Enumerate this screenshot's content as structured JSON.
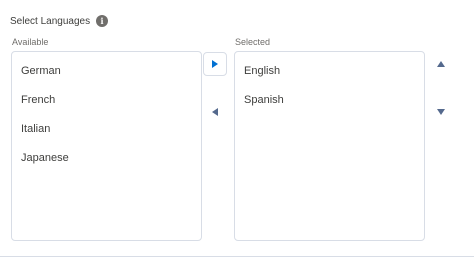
{
  "header": {
    "title": "Select Languages",
    "info_icon": "i"
  },
  "available": {
    "label": "Available",
    "items": [
      "German",
      "French",
      "Italian",
      "Japanese"
    ]
  },
  "selected": {
    "label": "Selected",
    "items": [
      "English",
      "Spanish"
    ]
  },
  "icons": {
    "move_right": "right-triangle",
    "move_left": "left-triangle",
    "move_up": "up-triangle",
    "move_down": "down-triangle"
  },
  "colors": {
    "accent": "#0070d2",
    "border": "#d8dde6",
    "icon": "#54698d"
  }
}
